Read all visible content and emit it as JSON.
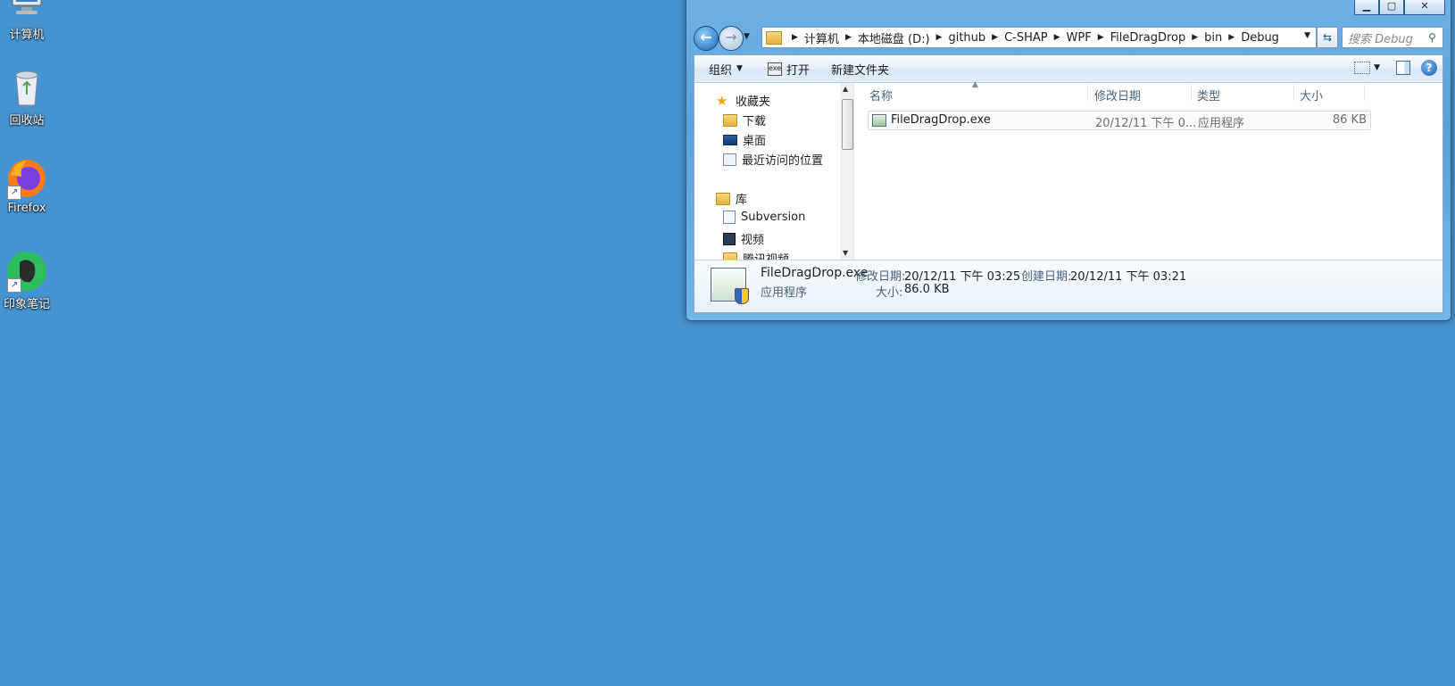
{
  "desktop": {
    "icons": [
      {
        "label": "计算机"
      },
      {
        "label": "回收站"
      },
      {
        "label": "Firefox"
      },
      {
        "label": "印象笔记"
      }
    ]
  },
  "window": {
    "caption": {
      "minimize": "▁",
      "maximize": "▢",
      "close": "✕"
    },
    "address": {
      "crumbs": [
        "计算机",
        "本地磁盘 (D:)",
        "github",
        "C-SHAP",
        "WPF",
        "FileDragDrop",
        "bin",
        "Debug"
      ]
    },
    "search": {
      "placeholder": "搜索 Debug"
    },
    "toolbar": {
      "organize": "组织",
      "open": "打开",
      "new_folder": "新建文件夹"
    },
    "nav": {
      "favorites": "收藏夹",
      "downloads": "下载",
      "desktop": "桌面",
      "recent": "最近访问的位置",
      "libraries": "库",
      "subversion": "Subversion",
      "videos": "视频",
      "partial": "腾讯视频"
    },
    "columns": {
      "name": "名称",
      "modified": "修改日期",
      "type": "类型",
      "size": "大小"
    },
    "files": [
      {
        "name": "FileDragDrop.exe",
        "modified": "20/12/11 下午 0...",
        "type": "应用程序",
        "size": "86 KB"
      }
    ],
    "details": {
      "filename": "FileDragDrop.exe",
      "filetype": "应用程序",
      "modified_label": "修改日期:",
      "modified_value": "20/12/11 下午 03:25",
      "created_label": "创建日期:",
      "created_value": "20/12/11 下午 03:21",
      "size_label": "大小:",
      "size_value": "86.0 KB"
    }
  }
}
